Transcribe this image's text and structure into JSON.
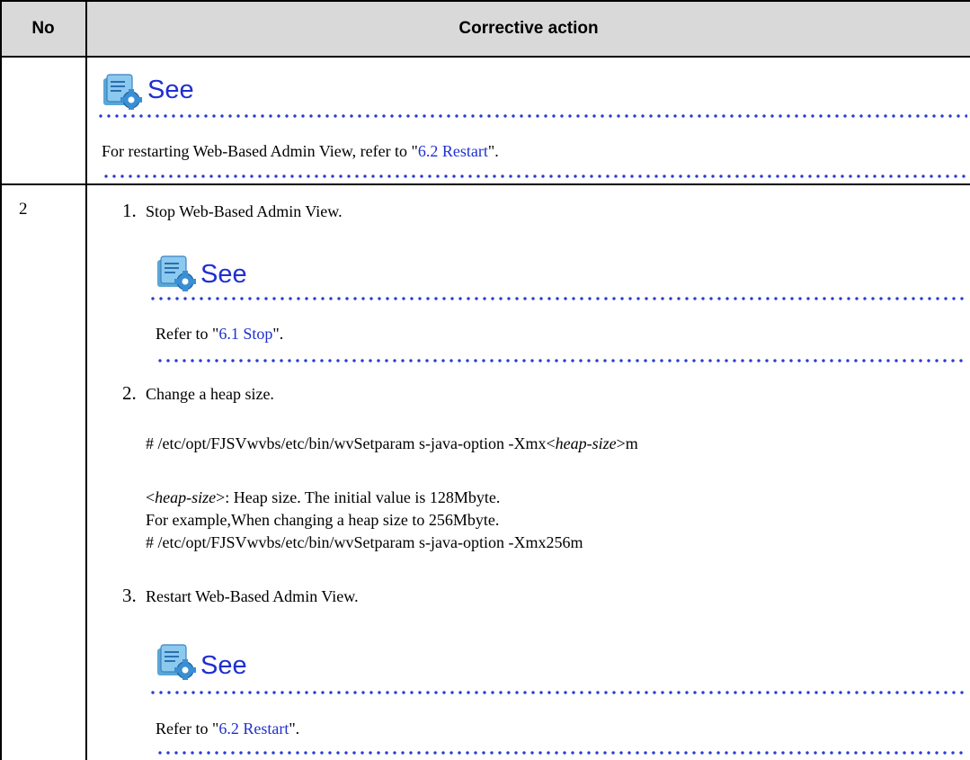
{
  "table": {
    "headers": {
      "no": "No",
      "action": "Corrective action"
    }
  },
  "row1": {
    "see_title": "See",
    "text_before": "For restarting Web-Based Admin View, refer to \"",
    "link": "6.2 Restart",
    "text_after": "\"."
  },
  "row2": {
    "no": "2",
    "steps": [
      {
        "num": "1.",
        "text": "Stop Web-Based Admin View.",
        "see_title": "See",
        "ref_before": "Refer to \"",
        "ref_link": "6.1 Stop",
        "ref_after": "\"."
      },
      {
        "num": "2.",
        "text": "Change a heap size.",
        "cmd_prefix": "# /etc/opt/FJSVwvbs/etc/bin/wvSetparam s-java-option -Xmx<",
        "cmd_var": "heap-size",
        "cmd_suffix": ">m",
        "desc_open": "<",
        "desc_var": "heap-size",
        "desc_rest": ">: Heap size. The initial value is 128Mbyte.",
        "example": "For example,When changing a heap size to 256Mbyte.",
        "example_cmd": "# /etc/opt/FJSVwvbs/etc/bin/wvSetparam s-java-option -Xmx256m"
      },
      {
        "num": "3.",
        "text": "Restart Web-Based Admin View.",
        "see_title": "See",
        "ref_before": "Refer to \"",
        "ref_link": "6.2 Restart",
        "ref_after": "\"."
      }
    ]
  },
  "icons": {
    "see": "document-gear-icon"
  },
  "colors": {
    "header_bg": "#d9d9d9",
    "link": "#1f2fd1",
    "dots": "#2a3bcf"
  }
}
